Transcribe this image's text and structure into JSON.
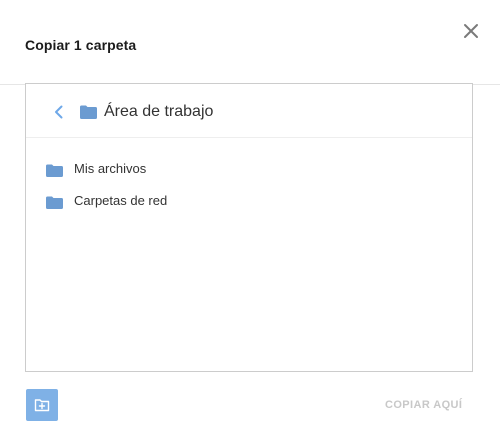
{
  "dialog": {
    "title": "Copiar 1 carpeta",
    "close_icon": "close-icon"
  },
  "browser": {
    "back_icon": "chevron-left-icon",
    "current_folder_icon": "folder-icon",
    "current_folder": "Área de trabajo",
    "items": [
      {
        "icon": "folder-icon",
        "label": "Mis archivos"
      },
      {
        "icon": "folder-icon",
        "label": "Carpetas de red"
      }
    ]
  },
  "footer": {
    "new_folder_icon": "new-folder-icon",
    "copy_here_label": "COPIAR AQUÍ"
  },
  "colors": {
    "accent": "#7fb1e6",
    "folder": "#6b9bd1",
    "disabled_text": "#c8c8c8",
    "border": "#cccccc"
  }
}
